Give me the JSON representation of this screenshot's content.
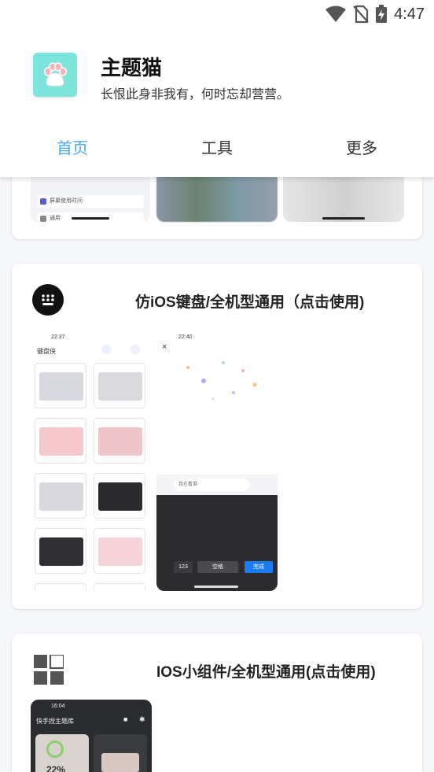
{
  "status_bar": {
    "time": "4:47"
  },
  "header": {
    "app_name": "主题猫",
    "app_subtitle": "长恨此身非我有，何时忘却营营。",
    "tabs": [
      {
        "label": "首页",
        "active": true
      },
      {
        "label": "工具",
        "active": false
      },
      {
        "label": "更多",
        "active": false
      }
    ]
  },
  "cards": [
    {
      "title": "",
      "preview_texts": [
        "屏幕使用时间",
        "通用"
      ]
    },
    {
      "title": "仿iOS键盘/全机型通用（点击使用)",
      "left_preview": {
        "time": "22:37",
        "heading": "键盘侠"
      },
      "right_preview": {
        "time": "22:40",
        "input_placeholder": "我在看谁",
        "space_key": "空格",
        "enter_key": "完成",
        "num_key": "123"
      }
    },
    {
      "title": "IOS小组件/全机型通用(点击使用)",
      "preview": {
        "time": "16:04",
        "heading": "快手捏主题库",
        "value": "22%"
      }
    }
  ],
  "colors": {
    "accent": "#4aa8ee",
    "app_icon_bg": "#7ee5dc",
    "keyboard_enter": "#1a7cf5"
  }
}
